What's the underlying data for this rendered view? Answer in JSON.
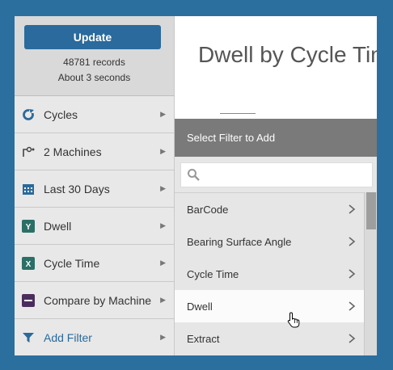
{
  "sidebar": {
    "update_label": "Update",
    "records": "48781 records",
    "duration": "About 3 seconds",
    "items": [
      {
        "label": "Cycles",
        "icon": "cycle-icon"
      },
      {
        "label": "2 Machines",
        "icon": "machines-icon"
      },
      {
        "label": "Last 30 Days",
        "icon": "calendar-icon"
      },
      {
        "label": "Dwell",
        "icon": "y-axis-icon"
      },
      {
        "label": "Cycle Time",
        "icon": "x-axis-icon"
      },
      {
        "label": "Compare by Machine",
        "icon": "compare-icon"
      },
      {
        "label": "Add Filter",
        "icon": "filter-icon"
      }
    ]
  },
  "main": {
    "title": "Dwell by Cycle Tim"
  },
  "filter_popup": {
    "header": "Select Filter to Add",
    "search_placeholder": "",
    "options": [
      "BarCode",
      "Bearing Surface Angle",
      "Cycle Time",
      "Dwell",
      "Extract"
    ]
  },
  "colors": {
    "accent": "#2a6a9c",
    "background": "#2b6f9e",
    "dwell_icon": "#2b6f66",
    "cycle_icon": "#2a6a9c"
  }
}
